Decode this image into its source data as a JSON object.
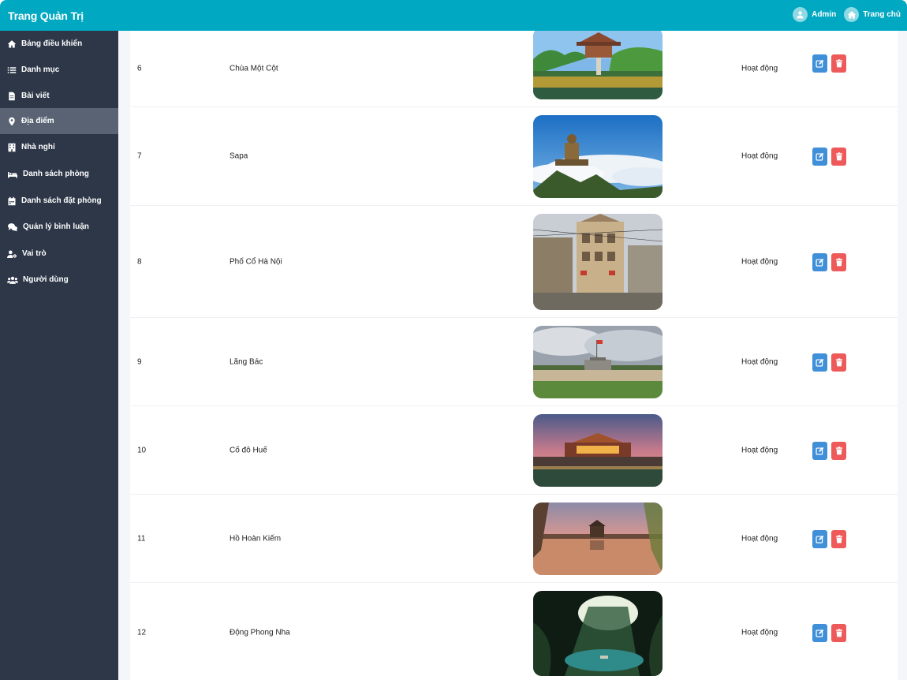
{
  "header": {
    "title": "Trang Quản Trị",
    "user_label": "Admin",
    "home_label": "Trang chủ"
  },
  "sidebar": {
    "items": [
      {
        "label": "Bảng điều khiển",
        "icon": "home-icon"
      },
      {
        "label": "Danh mục",
        "icon": "list-icon"
      },
      {
        "label": "Bài viết",
        "icon": "file-icon"
      },
      {
        "label": "Địa điểm",
        "icon": "map-pin-icon",
        "active": true
      },
      {
        "label": "Nhà nghỉ",
        "icon": "building-icon"
      },
      {
        "label": "Danh sách phòng",
        "icon": "bed-icon"
      },
      {
        "label": "Danh sách đặt phòng",
        "icon": "calendar-icon"
      },
      {
        "label": "Quản lý bình luận",
        "icon": "comments-icon"
      },
      {
        "label": "Vai trò",
        "icon": "user-cog-icon"
      },
      {
        "label": "Người dùng",
        "icon": "users-icon"
      }
    ]
  },
  "table": {
    "rows": [
      {
        "id": "6",
        "name": "Chùa Một Cột",
        "status": "Hoạt động",
        "image": "one-pillar-pagoda"
      },
      {
        "id": "7",
        "name": "Sapa",
        "status": "Hoạt động",
        "image": "sapa-mountain-statue"
      },
      {
        "id": "8",
        "name": "Phố Cổ Hà Nội",
        "status": "Hoạt động",
        "image": "hanoi-old-quarter"
      },
      {
        "id": "9",
        "name": "Lăng Bác",
        "status": "Hoạt động",
        "image": "ho-chi-minh-mausoleum"
      },
      {
        "id": "10",
        "name": "Cố đô Huế",
        "status": "Hoạt động",
        "image": "hue-citadel"
      },
      {
        "id": "11",
        "name": "Hồ Hoàn Kiếm",
        "status": "Hoạt động",
        "image": "hoan-kiem-lake"
      },
      {
        "id": "12",
        "name": "Động Phong Nha",
        "status": "Hoạt động",
        "image": "phong-nha-cave"
      }
    ]
  },
  "colors": {
    "header_bg": "#00a8c1",
    "sidebar_bg": "#2d3748",
    "sidebar_active": "#596373",
    "edit_button": "#3f8fd9",
    "delete_button": "#ee5a5a"
  }
}
